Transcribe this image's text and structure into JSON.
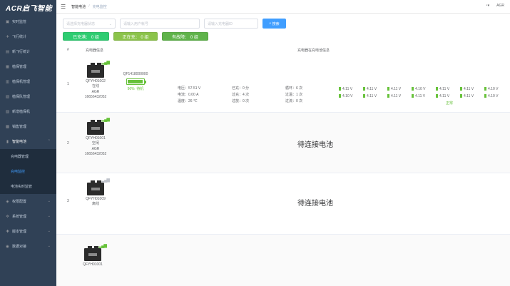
{
  "sidebar": {
    "logo": "ACR启飞智能",
    "items": [
      {
        "label": "实时监管",
        "icon": "monitor-icon",
        "arrow": false
      },
      {
        "label": "飞行统计",
        "icon": "plane-icon",
        "arrow": false
      },
      {
        "label": "新飞行统计",
        "icon": "chart-icon",
        "arrow": false
      },
      {
        "label": "植保管理",
        "icon": "leaf-icon",
        "arrow": false
      },
      {
        "label": "植保机管理",
        "icon": "drone-icon",
        "arrow": false
      },
      {
        "label": "植保队管理",
        "icon": "team-icon",
        "arrow": false
      },
      {
        "label": "新增植保机",
        "icon": "add-icon",
        "arrow": false
      },
      {
        "label": "销售管理",
        "icon": "cart-icon",
        "arrow": false
      },
      {
        "label": "智能电池",
        "icon": "battery-icon",
        "arrow": true
      }
    ],
    "sub_items": [
      {
        "label": "充电器管理"
      },
      {
        "label": "充电监控"
      },
      {
        "label": "电池实时监管"
      }
    ],
    "bottom_items": [
      {
        "label": "权限配置",
        "icon": "lock-icon"
      },
      {
        "label": "系统管理",
        "icon": "gear-icon"
      },
      {
        "label": "版本管理",
        "icon": "version-icon"
      },
      {
        "label": "数据对接",
        "icon": "link-icon"
      }
    ]
  },
  "header": {
    "breadcrumb_root": "智能电池",
    "breadcrumb_current": "充电监控",
    "user": "AGR"
  },
  "filters": {
    "status_placeholder": "请选择充电器状态",
    "user_placeholder": "请输入用户帐号",
    "number_placeholder": "请输入充电器ID",
    "search_label": "搜索"
  },
  "tags": {
    "full": "已充满： 0 组",
    "charging": "正在充： 0 组",
    "fault": "有故障： 0 组"
  },
  "table": {
    "col_index": "#",
    "col_charger": "充电器信息",
    "col_battery": "充电器在充电池信息"
  },
  "rows": [
    {
      "index": "1",
      "charger_id": "QFYH01002",
      "status": "在线",
      "owner": "AGR",
      "phone": "16656432052",
      "battery_id": "QF1418000000",
      "percent": "96%",
      "percent_value": 0.96,
      "battery_state": "待机",
      "voltage": "电压：57.51 V",
      "current": "电流：0.00 A",
      "temp": "温度：26 ℃",
      "charged": "已充：0 分",
      "overcharge": "过充：4 次",
      "overdischarge": "过放：0 次",
      "cycles": "循环：6 次",
      "over_temp": "过温：1 次",
      "overcurrent": "过流：0 次",
      "cells_row1": [
        "4.11 V",
        "4.11 V",
        "4.11 V",
        "4.10 V",
        "4.11 V",
        "4.11 V",
        "4.10 V"
      ],
      "cells_row2": [
        "4.10 V",
        "4.11 V",
        "4.11 V",
        "4.11 V",
        "4.11 V",
        "4.11 V",
        "4.10 V"
      ],
      "cell_status": "正常"
    },
    {
      "index": "2",
      "charger_id": "QFYH01001",
      "status": "空闲",
      "owner": "AGR",
      "phone": "16656432052",
      "waiting": "待连接电池"
    },
    {
      "index": "3",
      "charger_id": "QFYH01009",
      "status": "离线",
      "waiting": "待连接电池"
    },
    {
      "index": "",
      "charger_id": "QFYH01001"
    }
  ],
  "colors": {
    "sidebar": "#304156",
    "primary": "#409eff",
    "green": "#2ecc71",
    "lightgreen": "#8bc34a",
    "darkgreen": "#5fb34a"
  }
}
